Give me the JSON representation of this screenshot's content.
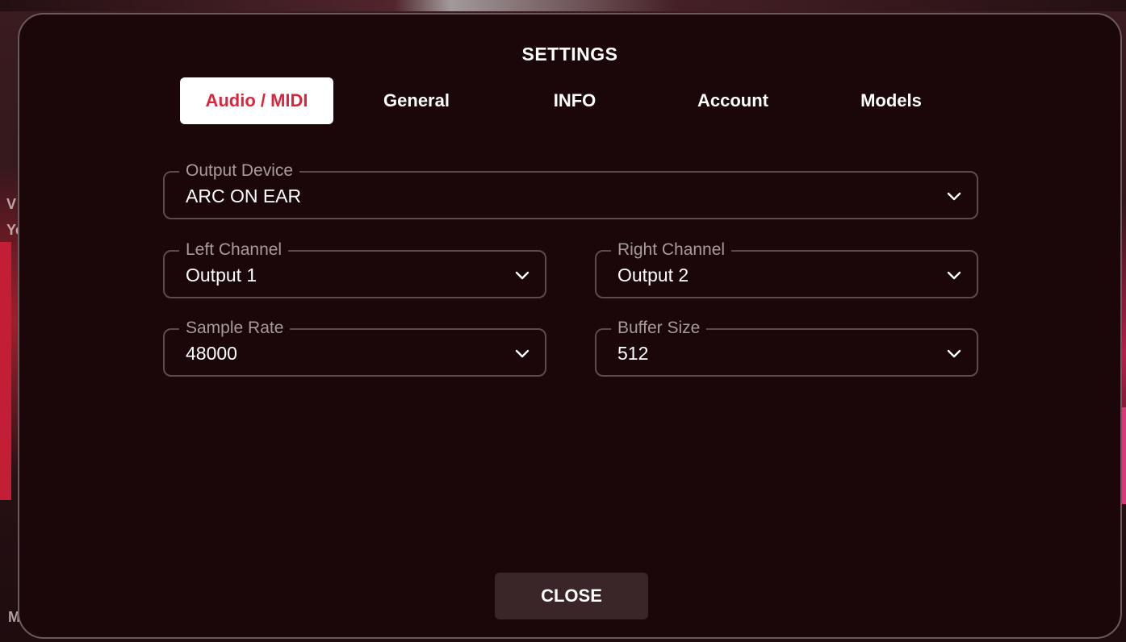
{
  "background": {
    "glyphs": [
      "Ye",
      "V",
      "M"
    ]
  },
  "modal": {
    "title": "SETTINGS",
    "tabs": [
      {
        "label": "Audio / MIDI",
        "active": true
      },
      {
        "label": "General",
        "active": false
      },
      {
        "label": "INFO",
        "active": false
      },
      {
        "label": "Account",
        "active": false
      },
      {
        "label": "Models",
        "active": false
      }
    ],
    "fields": {
      "output_device": {
        "label": "Output Device",
        "value": "ARC ON EAR"
      },
      "left_channel": {
        "label": "Left Channel",
        "value": "Output 1"
      },
      "right_channel": {
        "label": "Right Channel",
        "value": "Output 2"
      },
      "sample_rate": {
        "label": "Sample Rate",
        "value": "48000"
      },
      "buffer_size": {
        "label": "Buffer Size",
        "value": "512"
      }
    },
    "close_label": "CLOSE"
  },
  "colors": {
    "accent": "#e0233c",
    "modal_bg": "#1b0709",
    "field_border": "#5c4a4d",
    "label_text": "#a69c9d"
  },
  "icons": {
    "dropdown": "chevron-down-icon"
  }
}
